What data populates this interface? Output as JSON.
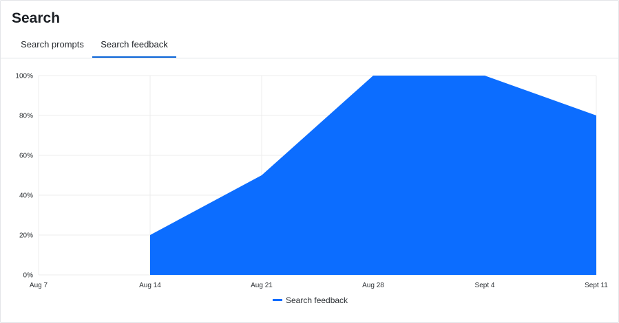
{
  "header": {
    "title": "Search"
  },
  "tabs": [
    {
      "label": "Search prompts",
      "active": false
    },
    {
      "label": "Search feedback",
      "active": true
    }
  ],
  "colors": {
    "accent": "#0a64d8",
    "series": "#0c6dff",
    "grid": "#ececec"
  },
  "chart_data": {
    "type": "area",
    "categories": [
      "Aug 7",
      "Aug 14",
      "Aug 21",
      "Aug 28",
      "Sept 4",
      "Sept 11"
    ],
    "series": [
      {
        "name": "Search feedback",
        "values": [
          null,
          20,
          50,
          100,
          100,
          80
        ]
      }
    ],
    "y_ticks": [
      "0%",
      "20%",
      "40%",
      "60%",
      "80%",
      "100%"
    ],
    "ylim": [
      0,
      100
    ],
    "grid": true,
    "legend": "bottom-center"
  }
}
